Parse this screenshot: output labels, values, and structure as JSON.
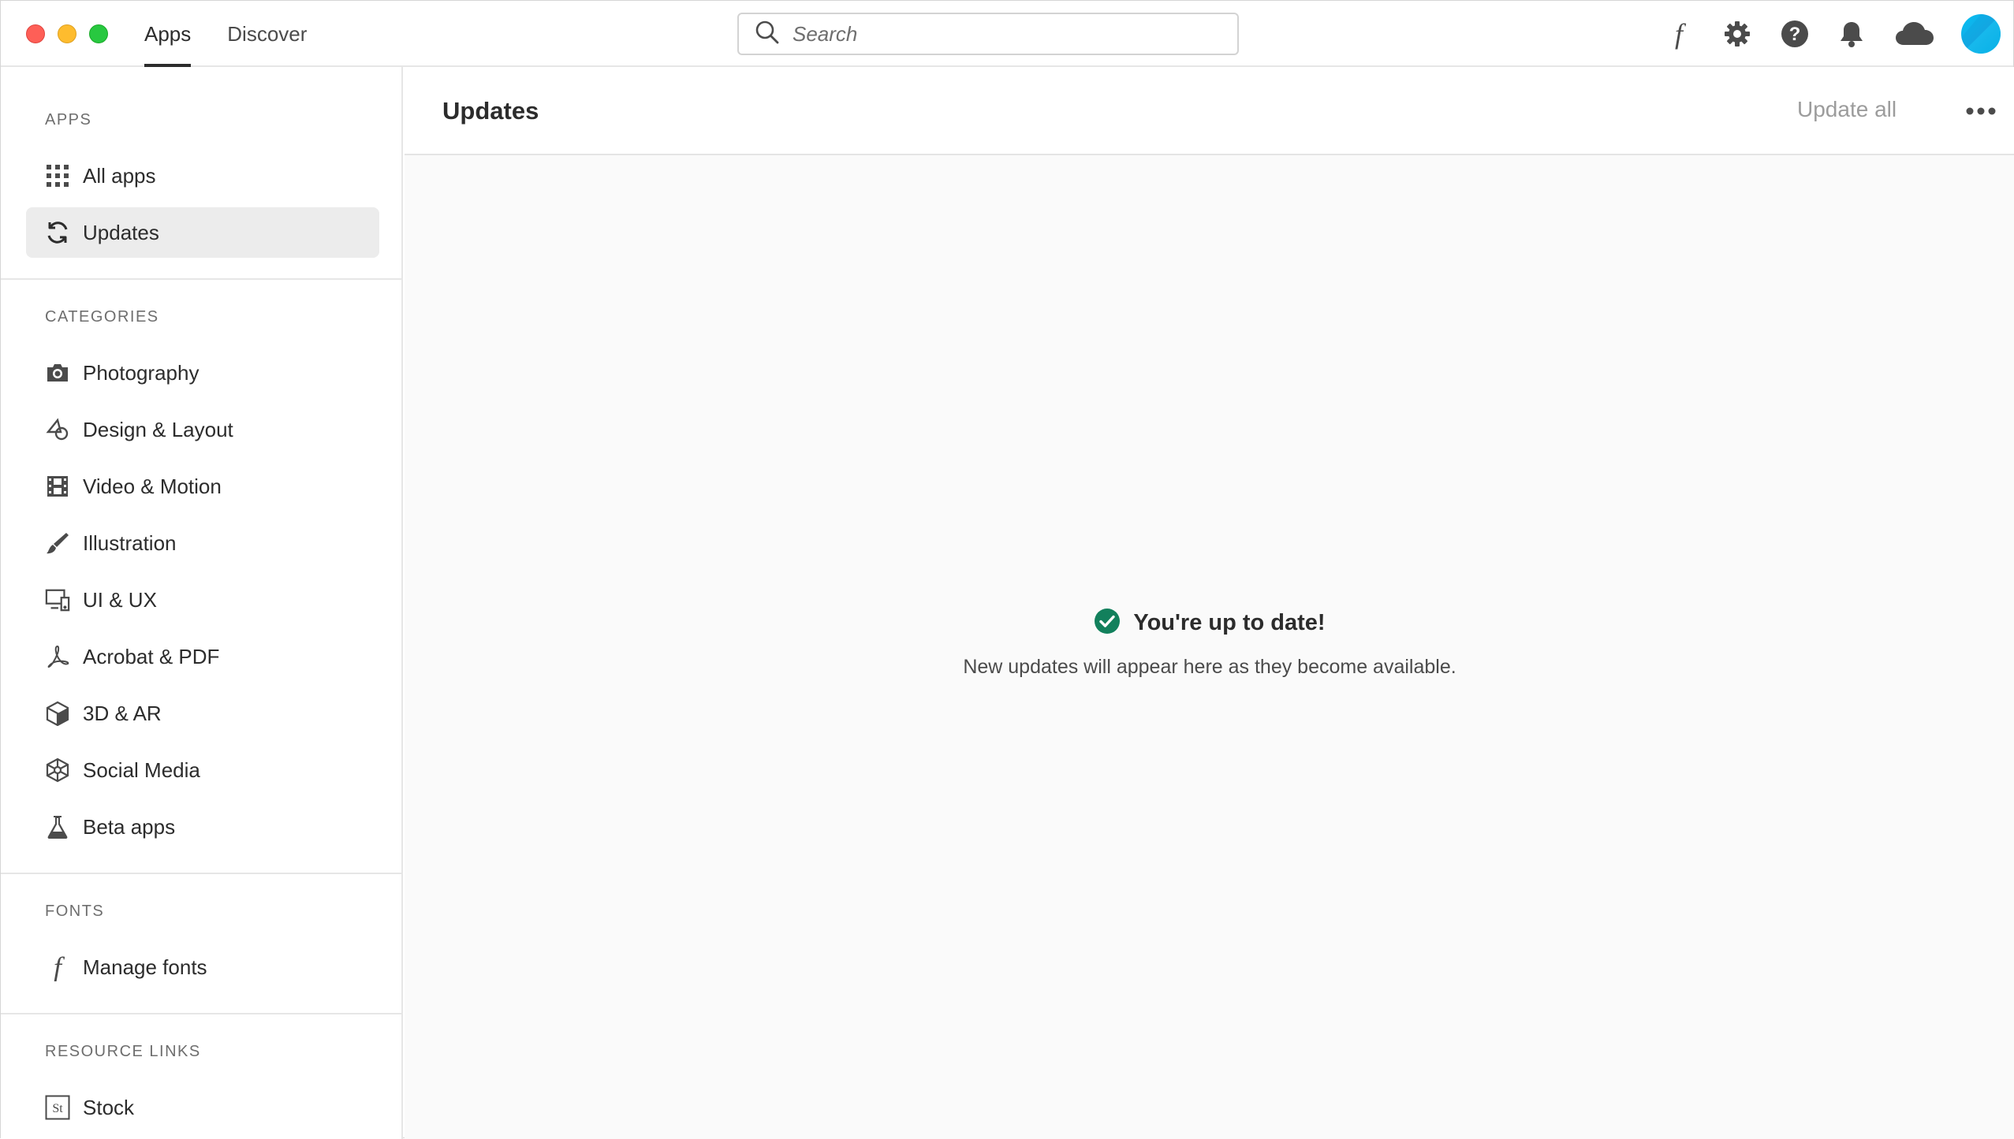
{
  "topbar": {
    "tabs": [
      {
        "label": "Apps",
        "active": true
      },
      {
        "label": "Discover",
        "active": false
      }
    ],
    "search": {
      "placeholder": "Search",
      "value": ""
    },
    "icons": [
      "fonts-icon",
      "gear-icon",
      "help-icon",
      "bell-icon",
      "cloud-icon",
      "avatar"
    ]
  },
  "sidebar": {
    "apps_title": "APPS",
    "apps_items": [
      {
        "label": "All apps",
        "icon": "grid-icon"
      },
      {
        "label": "Updates",
        "icon": "refresh-icon",
        "selected": true
      }
    ],
    "categories_title": "CATEGORIES",
    "categories": [
      {
        "label": "Photography",
        "icon": "camera-icon"
      },
      {
        "label": "Design & Layout",
        "icon": "shapes-icon"
      },
      {
        "label": "Video & Motion",
        "icon": "film-icon"
      },
      {
        "label": "Illustration",
        "icon": "brush-icon"
      },
      {
        "label": "UI & UX",
        "icon": "devices-icon"
      },
      {
        "label": "Acrobat & PDF",
        "icon": "acrobat-icon"
      },
      {
        "label": "3D & AR",
        "icon": "cube-icon"
      },
      {
        "label": "Social Media",
        "icon": "social-icon"
      },
      {
        "label": "Beta apps",
        "icon": "flask-icon"
      }
    ],
    "fonts_title": "FONTS",
    "fonts_items": [
      {
        "label": "Manage fonts",
        "icon": "fonts-icon"
      }
    ],
    "resources_title": "RESOURCE LINKS",
    "resource_items": [
      {
        "label": "Stock",
        "icon": "stock-icon",
        "badge": "St"
      }
    ]
  },
  "main": {
    "title": "Updates",
    "update_all_label": "Update all",
    "status_title": "You're up to date!",
    "status_subtitle": "New updates will appear here as they become available."
  },
  "colors": {
    "accent_dark": "#2c2c2c",
    "success": "#12805c",
    "selected_bg": "#ececec",
    "avatar": "#00c2f2"
  }
}
